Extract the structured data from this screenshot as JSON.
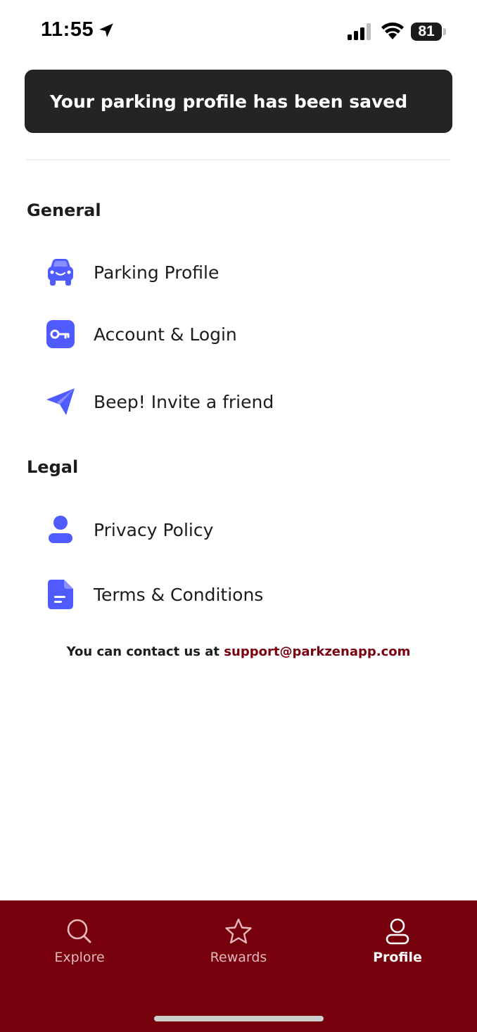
{
  "status_bar": {
    "time": "11:55",
    "battery": "81"
  },
  "toast": {
    "message": "Your parking profile has been saved"
  },
  "sections": {
    "general": {
      "title": "General",
      "items": [
        {
          "label": "Parking Profile",
          "icon": "car-icon"
        },
        {
          "label": "Account & Login",
          "icon": "key-icon"
        },
        {
          "label": "Beep! Invite a friend",
          "icon": "send-icon"
        }
      ]
    },
    "legal": {
      "title": "Legal",
      "items": [
        {
          "label": "Privacy Policy",
          "icon": "person-icon"
        },
        {
          "label": "Terms & Conditions",
          "icon": "document-icon"
        }
      ]
    }
  },
  "contact": {
    "prefix": "You can contact us at ",
    "email": "support@parkzenapp.com"
  },
  "bottom_nav": {
    "items": [
      {
        "label": "Explore",
        "icon": "search-icon",
        "active": false
      },
      {
        "label": "Rewards",
        "icon": "star-icon",
        "active": false
      },
      {
        "label": "Profile",
        "icon": "profile-icon",
        "active": true
      }
    ]
  },
  "colors": {
    "accent_icon": "#4f5bff",
    "brand": "#76000c",
    "toast_bg": "#242424",
    "link": "#7a0010"
  }
}
